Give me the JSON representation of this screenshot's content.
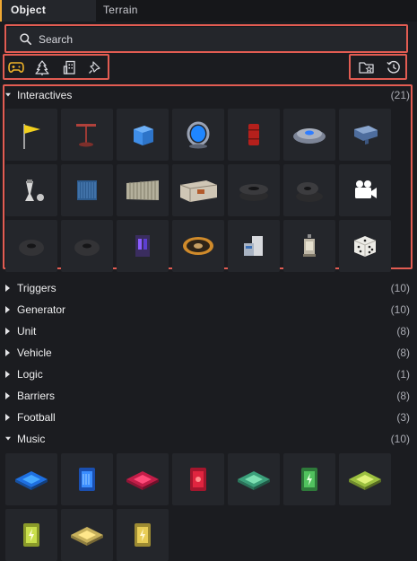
{
  "tabs": [
    {
      "label": "Object",
      "active": true
    },
    {
      "label": "Terrain",
      "active": false
    }
  ],
  "search": {
    "placeholder": "Search"
  },
  "toolbar": {
    "left_icons": [
      "gamepad-icon",
      "tree-icon",
      "building-icon",
      "pin-icon"
    ],
    "right_icons": [
      "favorite-folder-icon",
      "history-icon"
    ],
    "active_color": "#f0b429"
  },
  "categories": [
    {
      "name": "Interactives",
      "count": "(21)",
      "expanded": true,
      "items": [
        "yellow flag",
        "red lamp post",
        "blue cube",
        "blue portal",
        "red barrel",
        "grey drone pad",
        "blue shaped block",
        "white turret",
        "blue container",
        "metal fence",
        "shipping container",
        "tire stack",
        "tire stack",
        "camera",
        "tire",
        "tire",
        "purple machine",
        "round target",
        "rack machine",
        "lantern",
        "dice"
      ]
    },
    {
      "name": "Triggers",
      "count": "(10)",
      "expanded": false
    },
    {
      "name": "Generator",
      "count": "(10)",
      "expanded": false
    },
    {
      "name": "Unit",
      "count": "(8)",
      "expanded": false
    },
    {
      "name": "Vehicle",
      "count": "(8)",
      "expanded": false
    },
    {
      "name": "Logic",
      "count": "(1)",
      "expanded": false
    },
    {
      "name": "Barriers",
      "count": "(8)",
      "expanded": false
    },
    {
      "name": "Football",
      "count": "(3)",
      "expanded": false
    },
    {
      "name": "Music",
      "count": "(10)",
      "expanded": true,
      "items": [
        "blue music pad",
        "blue music panel",
        "pink music pad",
        "red music panel",
        "green music pad",
        "green music panel",
        "yellow-green music pad",
        "yellow music panel",
        "yellow music pad",
        "yellow music panel"
      ]
    }
  ],
  "colors": {
    "accent": "#f0a833",
    "highlight": "#e25c52",
    "panel": "#24262b",
    "background": "#1b1c20"
  }
}
